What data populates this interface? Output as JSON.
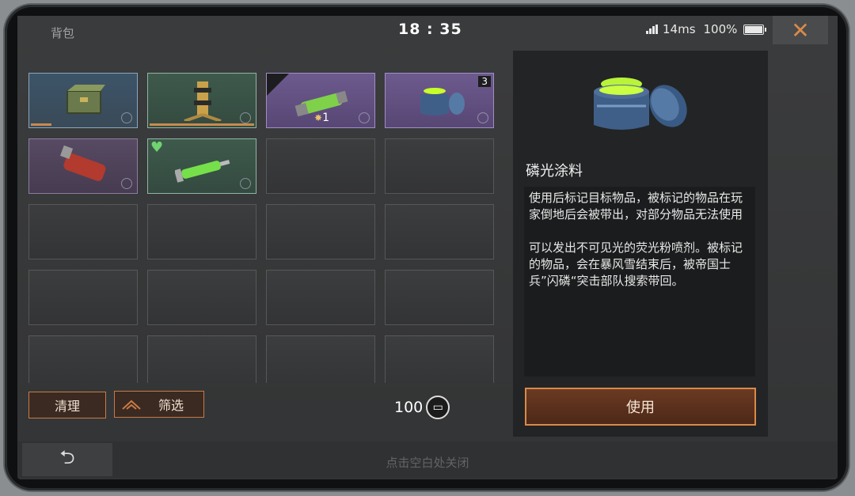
{
  "header": {
    "title": "背包",
    "clock": "18 : 35",
    "ping": "14ms",
    "battery": "100%"
  },
  "inventory": {
    "slots": [
      {
        "rarity": "blue",
        "icon": "supply-crate-icon",
        "bar": 0.2
      },
      {
        "rarity": "green",
        "icon": "brass-device-icon",
        "bar": 1.0
      },
      {
        "rarity": "purple",
        "icon": "green-canister-icon",
        "badge": "rank-chevron",
        "star_count": "1"
      },
      {
        "rarity": "purple",
        "icon": "phosphor-paint-jar-icon",
        "count": "3"
      },
      {
        "rarity": "dark-purple",
        "icon": "red-grenade-icon"
      },
      {
        "rarity": "green",
        "icon": "green-syringe-icon",
        "heart": "+"
      }
    ],
    "empty_slot_count": 14
  },
  "buttons": {
    "clean": "清理",
    "filter": "筛选",
    "use": "使用"
  },
  "currency": {
    "amount": "100",
    "icon": "ticket-icon"
  },
  "detail": {
    "name": "磷光涂料",
    "desc1": "使用后标记目标物品，被标记的物品在玩家倒地后会被带出，对部分物品无法使用",
    "desc2": "可以发出不可见光的荧光粉喷剂。被标记的物品，会在暴风雪结束后，被帝国士兵”闪磷“突击部队搜索带回。"
  },
  "footer": {
    "hint": "点击空白处关闭"
  },
  "colors": {
    "accent": "#c97a44",
    "panel": "#3a3b3c",
    "glow": "#c7ff2a"
  }
}
